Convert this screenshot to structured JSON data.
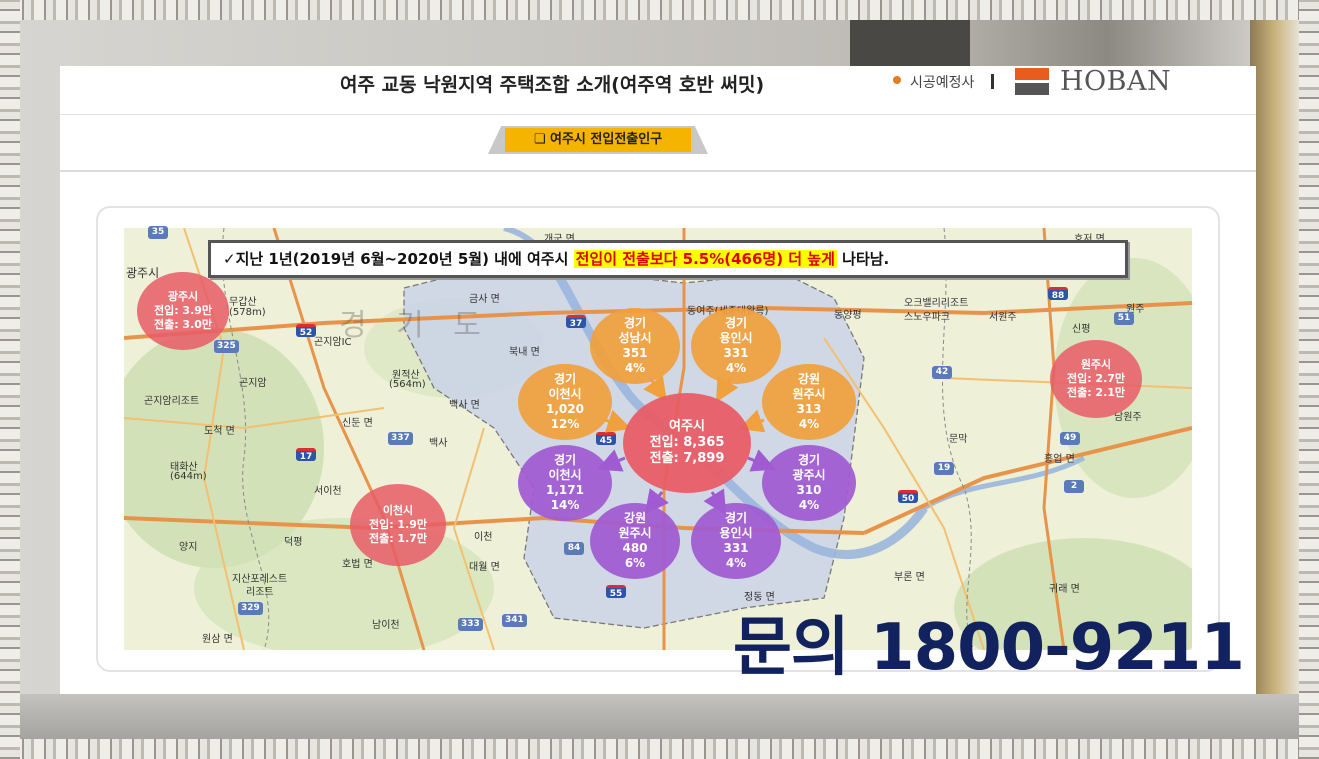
{
  "header": {
    "title": "여주 교동 낙원지역 주택조합 소개(여주역 호반 써밋)",
    "builder_label": "시공예정사",
    "logo_text": "HOBAN"
  },
  "section_tab": "여주시 전입전출인구",
  "notice": {
    "prefix": "✓지난 1년(2019년 6월~2020년 5월) 내에 여주시 ",
    "highlight": "전입이 전출보다 5.5%(466명) 더 높게",
    "suffix": " 나타남."
  },
  "map_labels": {
    "watermark": "경 기 도",
    "geumsa": "금사 면",
    "gaegun": "개군 면",
    "hojeo": "호저 면",
    "gwangjusi_edge": "광주시",
    "mugapsan": "무갑산",
    "mugapsan_h": "(578m)",
    "gonjiam_ic": "곤지암IC",
    "gonjiam": "곤지암",
    "gonjiam_resort": "곤지암리조트",
    "dochuk": "도척 면",
    "wonjeoksan": "원적산",
    "wonjeoksan_h": "(564m)",
    "baeksa": "백사 면",
    "baeksa2": "백사",
    "sindun": "신둔 면",
    "taehwasan": "태화산",
    "taehwasan_h": "(644m)",
    "seoicheon": "서이천",
    "yangji": "양지",
    "deokpyeong": "덕평",
    "hobeop": "호법 면",
    "jisan_resort": "지산포레스트",
    "jisan_resort2": "리조트",
    "wonsam": "원삼 면",
    "namicheon": "남이천",
    "icheon_label": "이천",
    "daewol": "대월 면",
    "bugnae": "북내 면",
    "yeoju_station": "동여주(세종대왕릉)",
    "oak_valley": "오크밸리리조트",
    "snowpark": "스노우파크",
    "seowon": "서원주",
    "munmak": "문막",
    "heungeop": "흥업 면",
    "gwirae": "귀래 면",
    "buron": "부론 면",
    "jeongdong": "정동 면",
    "wonju_edge": "원주",
    "sinpyeong": "신평",
    "namwonju": "남원주",
    "dongyang": "동양평"
  },
  "cities": {
    "gwangju": {
      "name": "광주시",
      "in": "전입: 3.9만",
      "out": "전출: 3.0만"
    },
    "wonju": {
      "name": "원주시",
      "in": "전입: 2.7만",
      "out": "전출: 2.1만"
    },
    "icheon": {
      "name": "이천시",
      "in": "전입: 1.9만",
      "out": "전출: 1.7만"
    },
    "yeoju": {
      "name": "여주시",
      "in": "전입: 8,365",
      "out": "전출: 7,899"
    }
  },
  "flows_in": [
    {
      "prov": "경기",
      "city": "성남시",
      "value": "351",
      "pct": "4%"
    },
    {
      "prov": "경기",
      "city": "용인시",
      "value": "331",
      "pct": "4%"
    },
    {
      "prov": "경기",
      "city": "이천시",
      "value": "1,020",
      "pct": "12%"
    },
    {
      "prov": "강원",
      "city": "원주시",
      "value": "313",
      "pct": "4%"
    }
  ],
  "flows_out": [
    {
      "prov": "경기",
      "city": "이천시",
      "value": "1,171",
      "pct": "14%"
    },
    {
      "prov": "경기",
      "city": "광주시",
      "value": "310",
      "pct": "4%"
    },
    {
      "prov": "강원",
      "city": "원주시",
      "value": "480",
      "pct": "6%"
    },
    {
      "prov": "경기",
      "city": "용인시",
      "value": "331",
      "pct": "4%"
    }
  ],
  "road_badges": [
    "35",
    "52",
    "325",
    "37",
    "45",
    "337",
    "17",
    "329",
    "333",
    "341",
    "84",
    "55",
    "88",
    "42",
    "49",
    "50",
    "19",
    "2",
    "51"
  ],
  "inquiry": "문의 1800-9211",
  "colors": {
    "inflow": "#f0a03c",
    "outflow": "#a05ad2",
    "center": "#e85a64",
    "highlight_text": "#e00000",
    "highlight_bg": "#ffff00",
    "inquiry": "#12225e",
    "logo_orange": "#e85d1e"
  }
}
